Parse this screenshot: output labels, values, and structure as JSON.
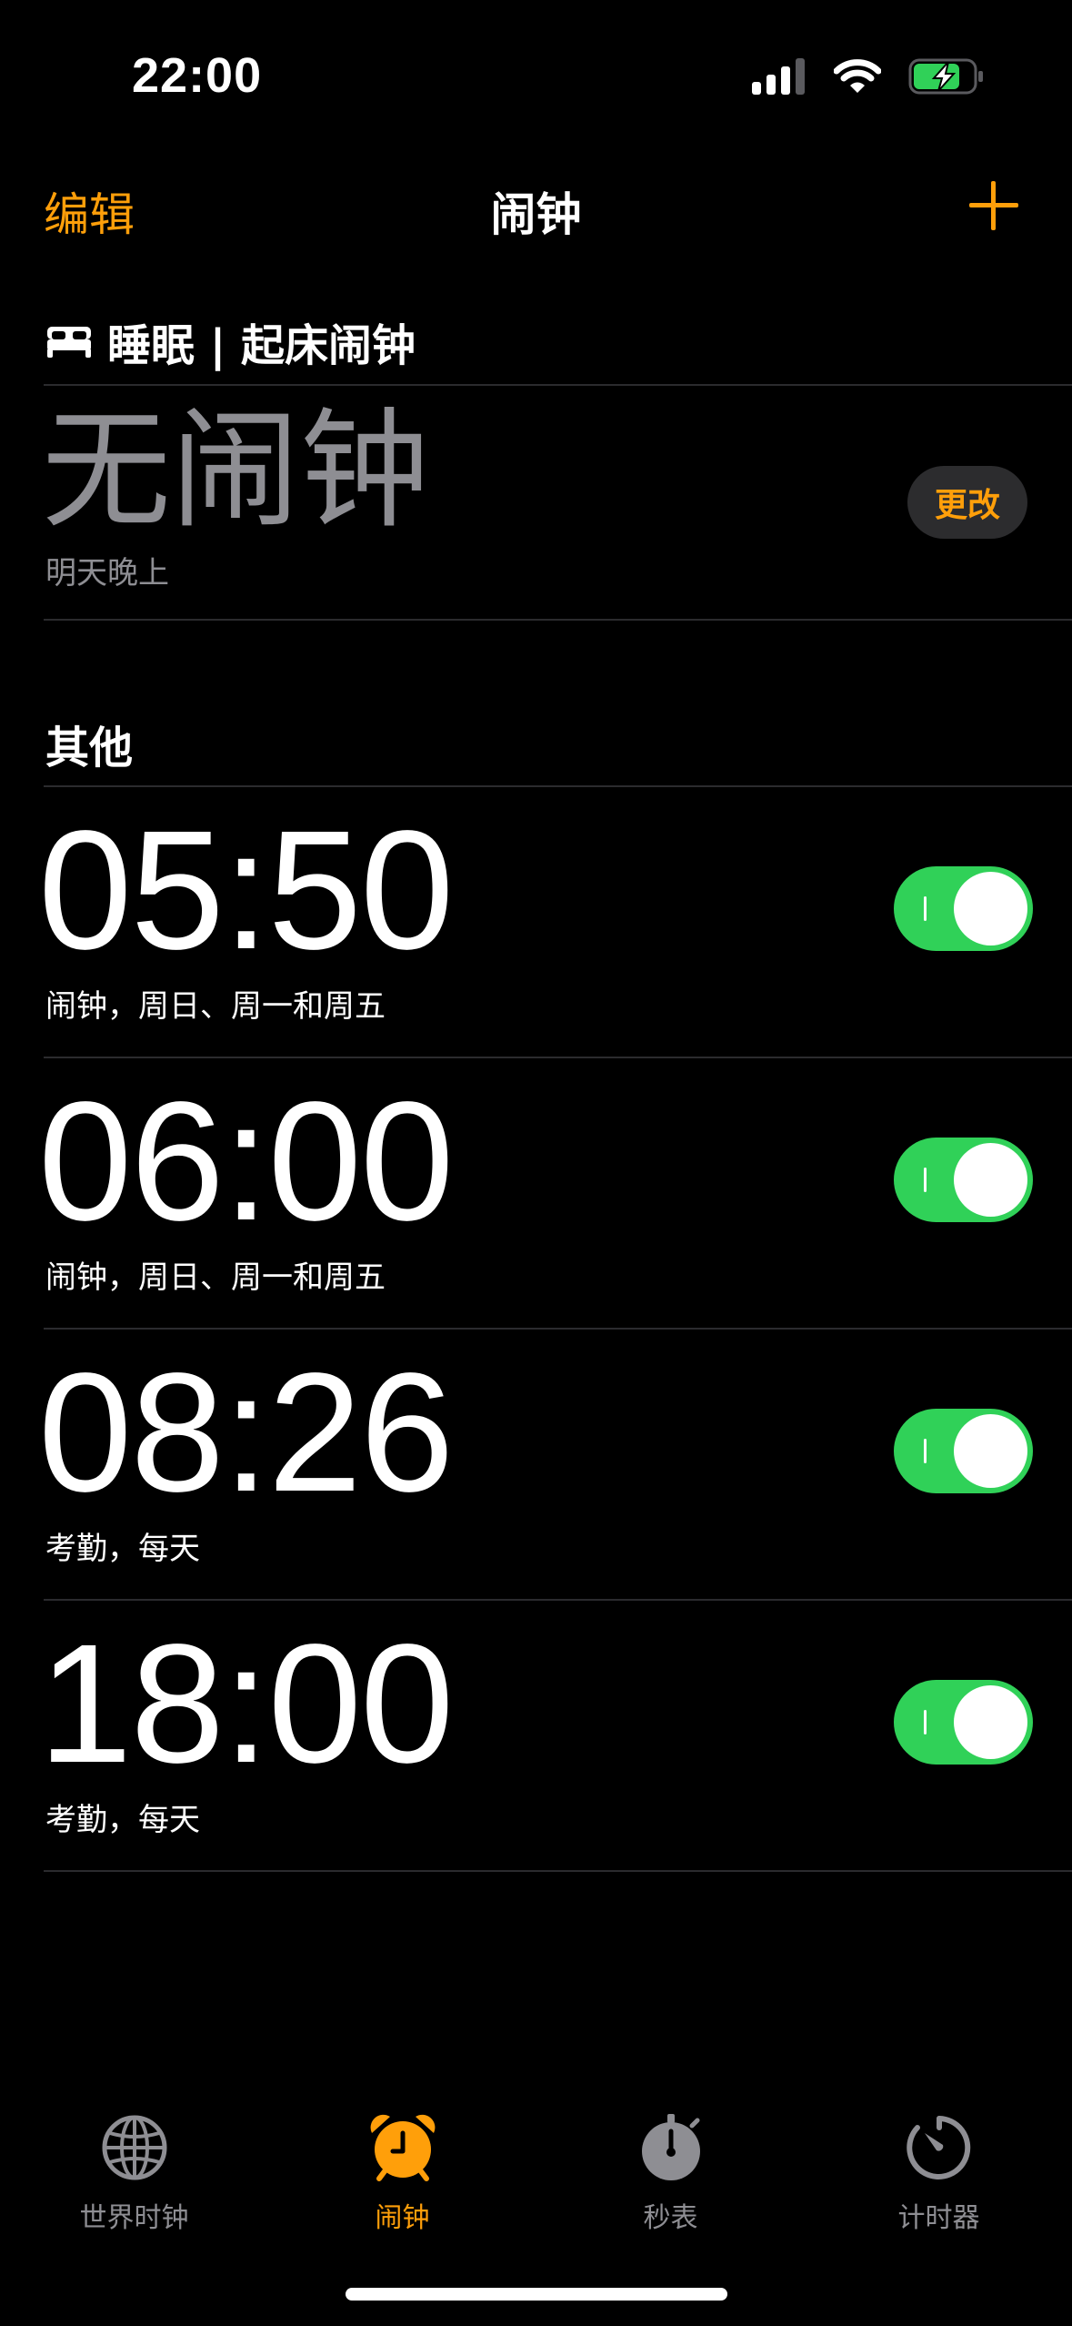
{
  "status_bar": {
    "time": "22:00"
  },
  "nav": {
    "edit_label": "编辑",
    "title": "闹钟"
  },
  "sleep": {
    "header": "睡眠 | 起床闹钟",
    "no_alarm": "无闹钟",
    "subtitle": "明天晚上",
    "change_label": "更改"
  },
  "other": {
    "title": "其他",
    "alarms": [
      {
        "time": "05:50",
        "label": "闹钟，周日、周一和周五",
        "enabled": true
      },
      {
        "time": "06:00",
        "label": "闹钟，周日、周一和周五",
        "enabled": true
      },
      {
        "time": "08:26",
        "label": "考勤，每天",
        "enabled": true
      },
      {
        "time": "18:00",
        "label": "考勤，每天",
        "enabled": true
      }
    ]
  },
  "tabbar": {
    "tabs": [
      {
        "label": "世界时钟",
        "icon": "globe-icon",
        "active": false
      },
      {
        "label": "闹钟",
        "icon": "alarm-clock-icon",
        "active": true
      },
      {
        "label": "秒表",
        "icon": "stopwatch-icon",
        "active": false
      },
      {
        "label": "计时器",
        "icon": "timer-icon",
        "active": false
      }
    ]
  },
  "colors": {
    "accent": "#ff9f0a",
    "toggle_on": "#30d158",
    "secondary_text": "#8e8e93",
    "background": "#000000"
  }
}
